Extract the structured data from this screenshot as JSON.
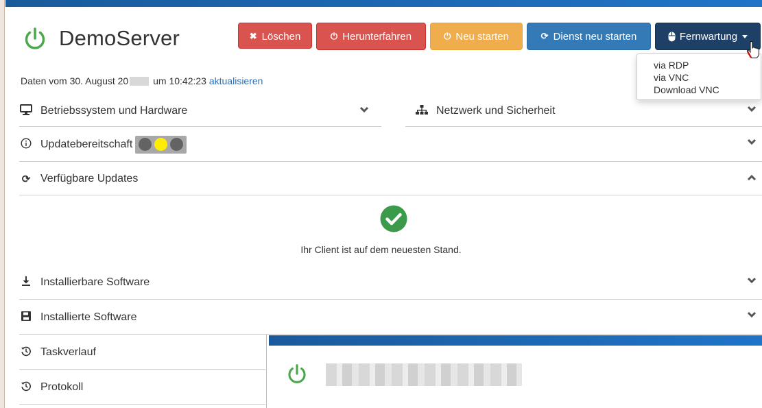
{
  "header": {
    "title": "DemoServer",
    "data_prefix": "Daten vom 30. August 20",
    "data_suffix": "um 10:42:23",
    "refresh_link": "aktualisieren"
  },
  "toolbar": {
    "delete": "Löschen",
    "shutdown": "Herunterfahren",
    "restart": "Neu starten",
    "restart_service": "Dienst neu starten",
    "remote": "Fernwartung"
  },
  "remote_menu": {
    "items": [
      "via RDP",
      "via VNC",
      "Download VNC"
    ]
  },
  "sections": {
    "os_hardware": "Betriebssystem und Hardware",
    "network_security": "Netzwerk und Sicherheit",
    "update_readiness": "Updatebereitschaft",
    "available_updates": "Verfügbare Updates",
    "installable_software": "Installierbare Software",
    "installed_software": "Installierte Software",
    "task_history": "Taskverlauf",
    "protocol": "Protokoll"
  },
  "updates_status": "Ihr Client ist auf dem neuesten Stand.",
  "traffic_light": {
    "active": "yellow",
    "colors": [
      "#636363",
      "#ffee00",
      "#636363"
    ]
  },
  "colors": {
    "danger": "#d9534f",
    "warning": "#f0ad4e",
    "primary": "#337ab7",
    "dark": "#1e3f66",
    "success": "#3c9a4b"
  },
  "icons": {
    "title": "power-icon",
    "delete": "x-icon",
    "shutdown": "power-icon",
    "restart": "power-icon",
    "service": "refresh-icon",
    "remote": "mouse-icon"
  }
}
